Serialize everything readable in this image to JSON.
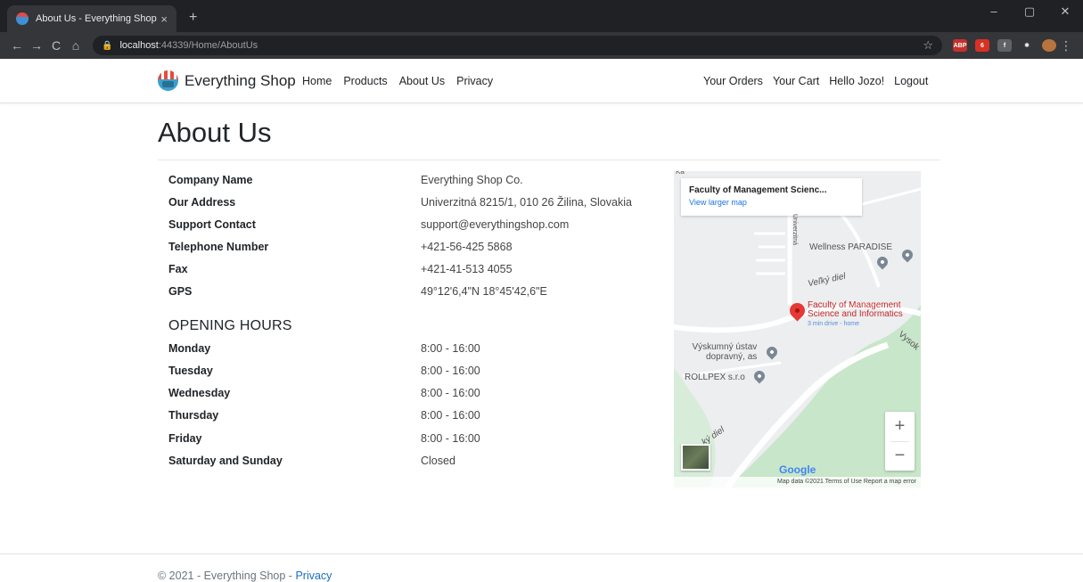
{
  "browser": {
    "tab_title": "About Us - Everything Shop",
    "tab_close": "×",
    "new_tab": "+",
    "url_host": "localhost",
    "url_path": ":44339/Home/AboutUs",
    "window_controls": [
      "–",
      "▢",
      "✕"
    ],
    "extensions": [
      {
        "name": "abp-icon",
        "text": "ABP",
        "color": "#c4302b"
      },
      {
        "name": "ext-red-icon",
        "text": "6",
        "color": "#d93025"
      },
      {
        "name": "ext-facebook-icon",
        "text": "f",
        "color": "#5f6368"
      },
      {
        "name": "puzzle-icon",
        "text": "✱",
        "color": "#35363a"
      },
      {
        "name": "profile-avatar-icon",
        "text": "",
        "color": "#b8743c"
      }
    ]
  },
  "nav": {
    "brand": "Everything Shop",
    "links": [
      "Home",
      "Products",
      "About Us",
      "Privacy"
    ],
    "right_links": [
      "Your Orders",
      "Your Cart",
      "Hello Jozo!",
      "Logout"
    ]
  },
  "page": {
    "title": "About Us",
    "company": [
      {
        "label": "Company Name",
        "value": "Everything Shop Co."
      },
      {
        "label": "Our Address",
        "value": "Univerzitná 8215/1, 010 26 Žilina, Slovakia"
      },
      {
        "label": "Support Contact",
        "value": "support@everythingshop.com"
      },
      {
        "label": "Telephone Number",
        "value": "+421-56-425 5868"
      },
      {
        "label": "Fax",
        "value": "+421-41-513 4055"
      },
      {
        "label": "GPS",
        "value": "49°12'6,4\"N 18°45'42,6\"E"
      }
    ],
    "hours_heading": "OPENING HOURS",
    "hours": [
      {
        "label": "Monday",
        "value": "8:00 - 16:00"
      },
      {
        "label": "Tuesday",
        "value": "8:00 - 16:00"
      },
      {
        "label": "Wednesday",
        "value": "8:00 - 16:00"
      },
      {
        "label": "Thursday",
        "value": "8:00 - 16:00"
      },
      {
        "label": "Friday",
        "value": "8:00 - 16:00"
      },
      {
        "label": "Saturday and Sunday",
        "value": "Closed"
      }
    ]
  },
  "map": {
    "card_title": "Faculty of Management Scienc...",
    "card_link": "View larger map",
    "place_line1": "Faculty of Management",
    "place_line2": "Science and Informatics",
    "place_sub": "3 min drive - home",
    "labels": [
      "Wellness PARADISE",
      "Veľký diel",
      "Výskumný ústav",
      "dopravný, as",
      "ROLLPEX s.r.o",
      "Univerzitná",
      "Vysok",
      "ký diel",
      "Ka"
    ],
    "zoom_in": "+",
    "zoom_out": "−",
    "google": "Google",
    "attribution": "Map data ©2021   Terms of Use   Report a map error"
  },
  "footer": {
    "text": "© 2021 - Everything Shop - ",
    "privacy": "Privacy"
  }
}
